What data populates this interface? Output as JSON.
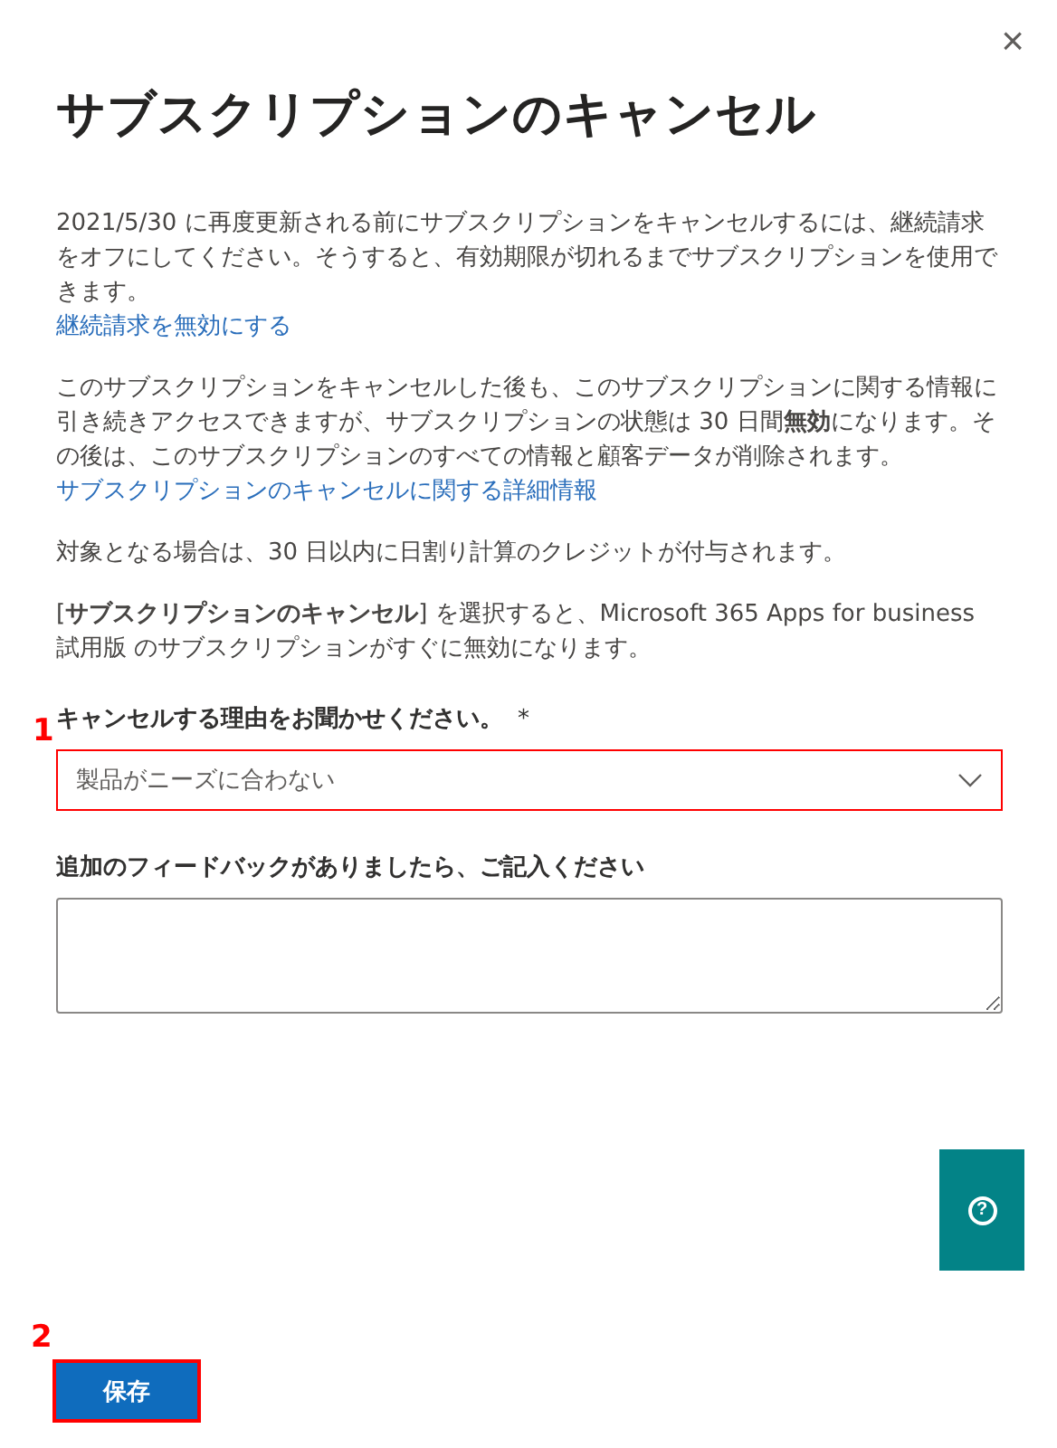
{
  "close_symbol": "×",
  "title": "サブスクリプションのキャンセル",
  "sections": [
    {
      "text": "2021/5/30 に再度更新される前にサブスクリプションをキャンセルするには、継続請求をオフにしてください。そうすると、有効期限が切れるまでサブスクリプションを使用できます。",
      "link": "継続請求を無効にする"
    },
    {
      "text": "このサブスクリプションをキャンセルした後も、このサブスクリプションに関する情報に引き続きアクセスできますが、サブスクリプションの状態は 30 日間**無効**になります。その後は、このサブスクリプションのすべての情報と顧客データが削除されます。",
      "link": "サブスクリプションのキャンセルに関する詳細情報"
    },
    {
      "text": "対象となる場合は、30 日以内に日割り計算のクレジットが付与されます。"
    },
    {
      "text": "[**サブスクリプションのキャンセル**] を選択すると、Microsoft 365 Apps for business 試用版 のサブスクリプションがすぐに無効になります。"
    }
  ],
  "reason": {
    "label": "キャンセルする理由をお聞かせください。",
    "required_mark": "*",
    "value": "製品がニーズに合わない",
    "callout": "1"
  },
  "feedback": {
    "label": "追加のフィードバックがありましたら、ご記入ください"
  },
  "help_button": {
    "symbol": "?"
  },
  "save_button": {
    "label": "保存",
    "callout": "2"
  }
}
